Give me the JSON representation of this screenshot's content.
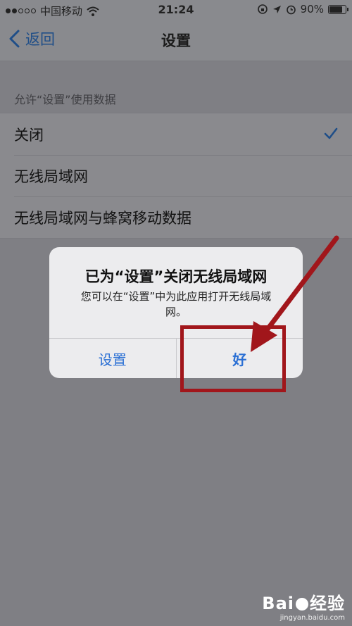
{
  "status_bar": {
    "carrier": "中国移动",
    "time": "21:24",
    "battery": "90%",
    "battery_level": 0.9
  },
  "nav": {
    "back_label": "返回",
    "title": "设置"
  },
  "section": {
    "header": "允许“设置”使用数据"
  },
  "options": [
    {
      "label": "关闭",
      "selected": true
    },
    {
      "label": "无线局域网",
      "selected": false
    },
    {
      "label": "无线局域网与蜂窝移动数据",
      "selected": false
    }
  ],
  "alert": {
    "title": "已为“设置”关闭无线局域网",
    "message": "您可以在“设置”中为此应用打开无线局域网。",
    "buttons": {
      "settings": "设置",
      "ok": "好"
    }
  },
  "watermark": {
    "logo": "Bai",
    "logo_suffix": "经验",
    "url": "jingyan.baidu.com"
  },
  "colors": {
    "accent": "#2a6fd4",
    "annotation": "#a1161b"
  }
}
